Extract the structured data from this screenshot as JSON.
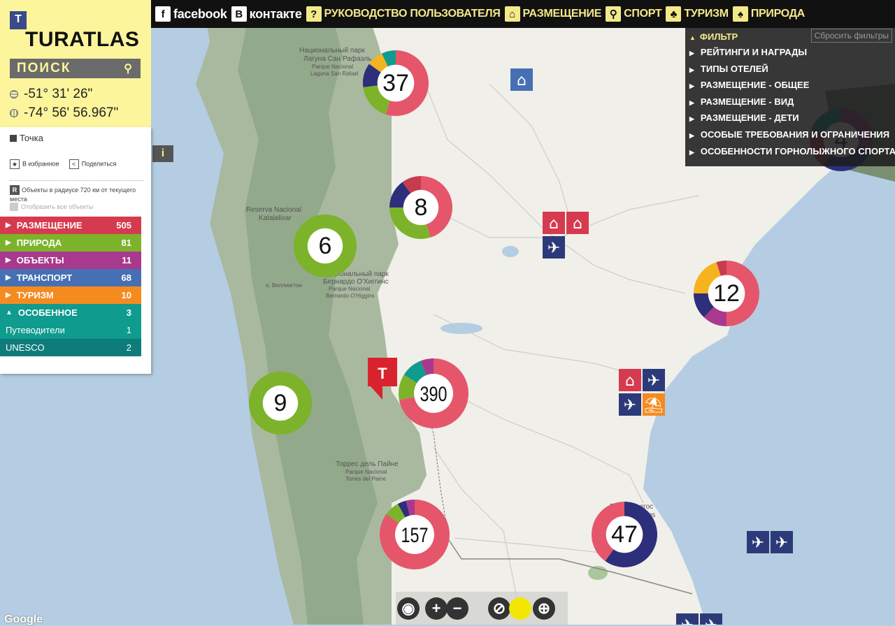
{
  "topbar": {
    "facebook": "facebook",
    "vkontakte": "контакте",
    "vk_letter": "B",
    "items": [
      {
        "icon": "help-icon",
        "glyph": "?",
        "label": "РУКОВОДСТВО ПОЛЬЗОВАТЕЛЯ"
      },
      {
        "icon": "house-icon",
        "glyph": "⌂",
        "label": "РАЗМЕЩЕНИЕ"
      },
      {
        "icon": "bicycle-icon",
        "glyph": "⚲",
        "label": "СПОРТ"
      },
      {
        "icon": "palm-icon",
        "glyph": "♣",
        "label": "ТУРИЗМ"
      },
      {
        "icon": "tree-icon",
        "glyph": "♠",
        "label": "ПРИРОДА"
      }
    ]
  },
  "logo": {
    "mark": "T",
    "text": "TURATLAS"
  },
  "search": {
    "label": "ПОИСК",
    "icon": "search-icon"
  },
  "coords": {
    "lat": "-51° 31' 26\"",
    "lon": "-74° 56' 56.967\""
  },
  "info_button": "i",
  "side": {
    "point": "Точка",
    "favorite": "В избранное",
    "share": "Поделиться",
    "radius_letter": "R",
    "radius_text": "Объекты в радиусе 720 км от текущего места",
    "show_all": "Отобразить все объекты"
  },
  "categories": [
    {
      "label": "РАЗМЕЩЕНИЕ",
      "count": "505",
      "color": "#d63a4e",
      "arrow": "▶"
    },
    {
      "label": "ПРИРОДА",
      "count": "81",
      "color": "#7cb32a",
      "arrow": "▶"
    },
    {
      "label": "ОБЪЕКТЫ",
      "count": "11",
      "color": "#a8398e",
      "arrow": "▶"
    },
    {
      "label": "ТРАНСПОРТ",
      "count": "68",
      "color": "#4670b3",
      "arrow": "▶"
    },
    {
      "label": "ТУРИЗМ",
      "count": "10",
      "color": "#f58b1f",
      "arrow": "▶"
    },
    {
      "label": "ОСОБЕННОЕ",
      "count": "3",
      "color": "#0f9b8e",
      "arrow": "▲"
    }
  ],
  "subitems": [
    {
      "label": "Путеводители",
      "count": "1"
    },
    {
      "label": "UNESCO",
      "count": "2"
    }
  ],
  "filter": {
    "head": "ФИЛЬТР",
    "reset": "Сбросить фильтры",
    "items": [
      "РЕЙТИНГИ И НАГРАДЫ",
      "ТИПЫ ОТЕЛЕЙ",
      "РАЗМЕЩЕНИЕ - ОБЩЕЕ",
      "РАЗМЕЩЕНИЕ - ВИД",
      "РАЗМЕЩЕНИЕ - ДЕТИ",
      "ОСОБЫЕ ТРЕБОВАНИЯ И ОГРАНИЧЕНИЯ",
      "ОСОБЕННОСТИ ГОРНОЛЫЖНОГО СПОРТА"
    ]
  },
  "map_labels": {
    "park1_line1": "Национальный парк",
    "park1_line2": "Лагуна Сан Рафаэль",
    "park1_line3": "Parque Nacional",
    "park1_line4": "Laguna San Rafael",
    "reserve_line1": "Reserva Nacional",
    "reserve_line2": "Katalalixar",
    "park2_line1": "Национальный парк",
    "park2_line2": "Бернардо О'Хиггинс",
    "park2_line3": "Parque Nacional",
    "park2_line4": "Bernardo O'Higgins",
    "wellington": "о. Веллингтон",
    "park3_line1": "Торрес дель Пайне",
    "park3_line2": "Parque Nacional",
    "park3_line3": "Torres del Paine",
    "gallegos_line1": "Рио-Гальегос",
    "gallegos_line2": "Rio Gallegos",
    "google": "Google"
  },
  "clusters": [
    {
      "count": "37",
      "segments": [
        {
          "color": "#e5566b",
          "value": 55
        },
        {
          "color": "#7cb32a",
          "value": 18
        },
        {
          "color": "#2d2f7a",
          "value": 12
        },
        {
          "color": "#f5b41f",
          "value": 8
        },
        {
          "color": "#0f9b8e",
          "value": 7
        }
      ]
    },
    {
      "count": "8",
      "segments": [
        {
          "color": "#e5566b",
          "value": 45
        },
        {
          "color": "#7cb32a",
          "value": 30
        },
        {
          "color": "#2d2f7a",
          "value": 15
        },
        {
          "color": "#c73b4f",
          "value": 10
        }
      ]
    },
    {
      "count": "6",
      "segments": [
        {
          "color": "#7cb32a",
          "value": 100
        }
      ]
    },
    {
      "count": "12",
      "segments": [
        {
          "color": "#e5566b",
          "value": 50
        },
        {
          "color": "#a8398e",
          "value": 12
        },
        {
          "color": "#2d2f7a",
          "value": 13
        },
        {
          "color": "#f5b41f",
          "value": 20
        },
        {
          "color": "#c73b4f",
          "value": 5
        }
      ]
    },
    {
      "count": "390",
      "segments": [
        {
          "color": "#e5566b",
          "value": 72
        },
        {
          "color": "#7cb32a",
          "value": 12
        },
        {
          "color": "#0f9b8e",
          "value": 10
        },
        {
          "color": "#a8398e",
          "value": 6
        }
      ]
    },
    {
      "count": "9",
      "segments": [
        {
          "color": "#7cb32a",
          "value": 100
        }
      ]
    },
    {
      "count": "157",
      "segments": [
        {
          "color": "#e5566b",
          "value": 85
        },
        {
          "color": "#7cb32a",
          "value": 7
        },
        {
          "color": "#2d2f7a",
          "value": 4
        },
        {
          "color": "#a8398e",
          "value": 4
        }
      ]
    },
    {
      "count": "47",
      "segments": [
        {
          "color": "#2d2f7a",
          "value": 60
        },
        {
          "color": "#e5566b",
          "value": 40
        }
      ]
    },
    {
      "count": "4",
      "segments": [
        {
          "color": "#a8398e",
          "value": 30
        },
        {
          "color": "#2d2f7a",
          "value": 30
        },
        {
          "color": "#c73b4f",
          "value": 20
        },
        {
          "color": "#0f9b8e",
          "value": 20
        }
      ]
    }
  ],
  "pins": [
    {
      "name": "hotel-icon",
      "glyph": "⌂",
      "color": "#d63a4e"
    },
    {
      "name": "hotel-icon",
      "glyph": "⌂",
      "color": "#d63a4e"
    },
    {
      "name": "airport-icon",
      "glyph": "✈",
      "color": "#2d3a7a"
    },
    {
      "name": "hotel-icon",
      "glyph": "⌂",
      "color": "#d63a4e"
    },
    {
      "name": "airport-icon",
      "glyph": "✈",
      "color": "#2d3a7a"
    },
    {
      "name": "airport-icon",
      "glyph": "✈",
      "color": "#2d3a7a"
    },
    {
      "name": "beach-icon",
      "glyph": "⛱",
      "color": "#f58b1f"
    },
    {
      "name": "airport-icon",
      "glyph": "✈",
      "color": "#2d3a7a"
    },
    {
      "name": "airport-icon",
      "glyph": "✈",
      "color": "#2d3a7a"
    },
    {
      "name": "airport-icon",
      "glyph": "✈",
      "color": "#2d3a7a"
    },
    {
      "name": "airport-icon",
      "glyph": "✈",
      "color": "#2d3a7a"
    },
    {
      "name": "unesco-icon",
      "glyph": "⌂",
      "color": "#4670b3"
    }
  ],
  "marker": {
    "letter": "T"
  },
  "tools": [
    {
      "name": "camera-button",
      "glyph": "◉"
    },
    {
      "name": "zoom-in-button",
      "glyph": "+"
    },
    {
      "name": "zoom-out-button",
      "glyph": "−"
    },
    {
      "name": "terrain-layer-button",
      "glyph": "⊘"
    },
    {
      "name": "satellite-layer-button",
      "glyph": "●"
    },
    {
      "name": "globe-layer-button",
      "glyph": "⊕"
    }
  ]
}
